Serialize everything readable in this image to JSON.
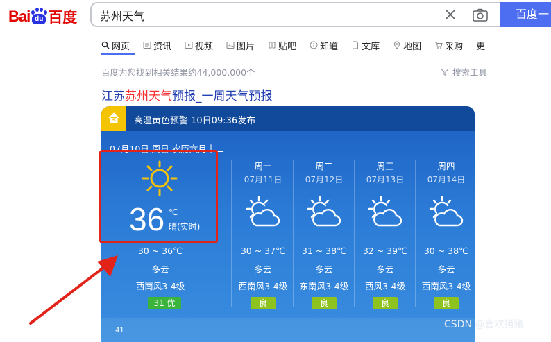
{
  "logo": {
    "part1": "Bai",
    "part2": "du",
    "part3": "百度"
  },
  "search": {
    "value": "苏州天气",
    "button_label": "百度一"
  },
  "tabs": [
    {
      "label": "网页",
      "icon": "search-icon"
    },
    {
      "label": "资讯",
      "icon": "news-icon"
    },
    {
      "label": "视频",
      "icon": "video-icon"
    },
    {
      "label": "图片",
      "icon": "image-icon"
    },
    {
      "label": "贴吧",
      "icon": "tieba-icon"
    },
    {
      "label": "知道",
      "icon": "question-icon"
    },
    {
      "label": "文库",
      "icon": "doc-icon"
    },
    {
      "label": "地图",
      "icon": "map-pin-icon"
    },
    {
      "label": "采购",
      "icon": "cart-icon"
    },
    {
      "label": "更"
    }
  ],
  "result_count": "百度为您找到相关结果约44,000,000个",
  "tools_label": "搜索工具",
  "result": {
    "title_pre": "江苏",
    "title_hl": "苏州天气",
    "title_post": "预报_一周天气预报"
  },
  "weather": {
    "alert": "高温黄色预警 10日09:36发布",
    "date_line": "07月10日 周日 农历六月十二",
    "today": {
      "temp": "36",
      "unit": "℃",
      "condition_now": "晴(实时)",
      "range": "30 ~ 36℃",
      "weather": "多云",
      "wind": "西南风3-4级",
      "aqi": "31  优"
    },
    "days": [
      {
        "day": "周一",
        "date": "07月11日",
        "range": "30 ~ 37℃",
        "weather": "多云",
        "wind": "西南风3-4级",
        "aqi": "良"
      },
      {
        "day": "周二",
        "date": "07月12日",
        "range": "31 ~ 38℃",
        "weather": "多云",
        "wind": "东南风3-4级",
        "aqi": "良"
      },
      {
        "day": "周三",
        "date": "07月13日",
        "range": "32 ~ 39℃",
        "weather": "多云",
        "wind": "西风3-4级",
        "aqi": "良"
      },
      {
        "day": "周四",
        "date": "07月14日",
        "range": "30 ~ 38℃",
        "weather": "多云",
        "wind": "西南风3-4级",
        "aqi": "良"
      }
    ],
    "graph_label": "41"
  },
  "watermark": "CSDN @喜欢猪猪",
  "colors": {
    "brand_blue": "#4e6ef2",
    "highlight_red": "#e2231a",
    "alert_yellow": "#f5c400",
    "aqi_good": "#3bb43b",
    "aqi_fine": "#8ec31f"
  }
}
